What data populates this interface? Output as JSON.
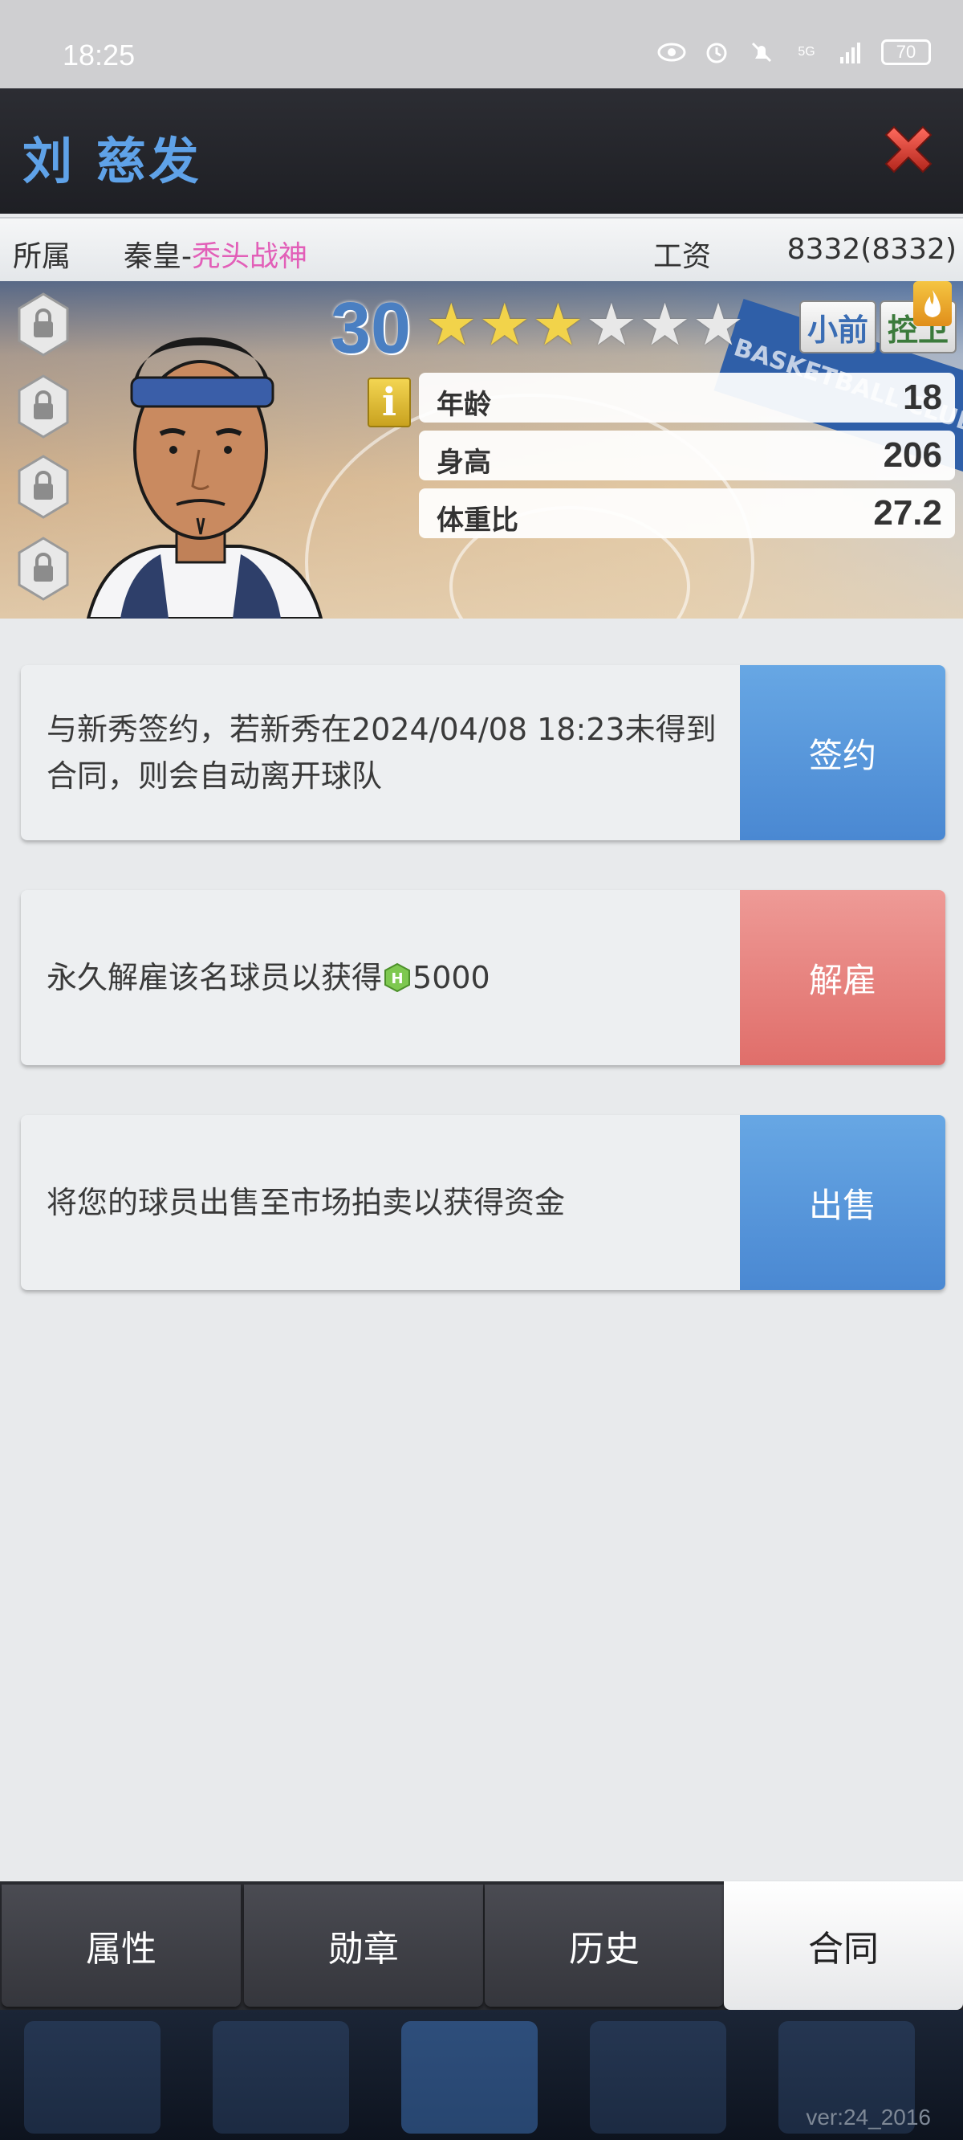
{
  "status_bar": {
    "time": "18:25",
    "icons": [
      "eye-icon",
      "alarm-icon",
      "mute-icon",
      "signal-5g-icon",
      "signal-bars-icon"
    ],
    "network": "5G",
    "battery": "70"
  },
  "header": {
    "player_name": "刘 慈发",
    "close_icon": "close-icon"
  },
  "info": {
    "team_label": "所属",
    "team_prefix": "秦皇-",
    "team_highlight": "秃头战神",
    "salary_label": "工资",
    "salary_value": "8332(8332)"
  },
  "player": {
    "rating": "30",
    "stars_total": 6,
    "stars_filled": 3,
    "positions": [
      "小前",
      "控卫"
    ],
    "info_icon_glyph": "i",
    "stats": [
      {
        "label": "年龄",
        "value": "18"
      },
      {
        "label": "身高",
        "value": "206"
      },
      {
        "label": "体重比",
        "value": "27.2"
      }
    ],
    "banner_text": "BASKETBALL CLUB",
    "colors": {
      "rating": "#4a7fc2",
      "position_1": "#3a6db4",
      "position_2": "#3b7a3b"
    }
  },
  "actions": [
    {
      "text": "与新秀签约，若新秀在2024/04/08 18:23未得到合同，则会自动离开球队",
      "button": "签约",
      "color": "#5a97dc"
    },
    {
      "text_before": "永久解雇该名球员以获得",
      "text_after": "5000",
      "button": "解雇",
      "color": "#e7837f"
    },
    {
      "text": "将您的球员出售至市场拍卖以获得资金",
      "button": "出售",
      "color": "#5a97dc"
    }
  ],
  "tabs": [
    {
      "label": "属性",
      "active": false
    },
    {
      "label": "勋章",
      "active": false
    },
    {
      "label": "历史",
      "active": false
    },
    {
      "label": "合同",
      "active": true
    }
  ],
  "version": "ver:24_2016"
}
